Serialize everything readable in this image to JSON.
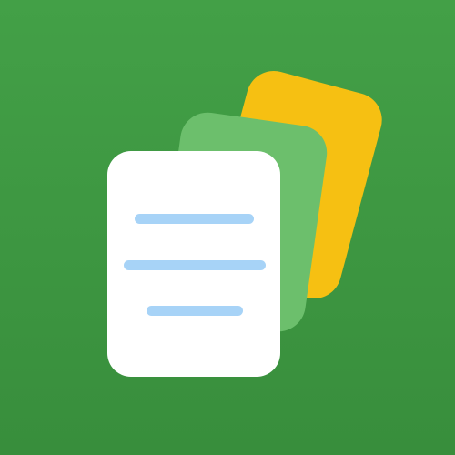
{
  "icon": {
    "name": "notes-stack-icon",
    "colors": {
      "background_top": "#43A047",
      "background_bottom": "#388E3C",
      "back_card": "#F6C012",
      "middle_card": "#6CBF6C",
      "front_card": "#FFFFFF",
      "text_lines": "#A7D3F7"
    }
  }
}
